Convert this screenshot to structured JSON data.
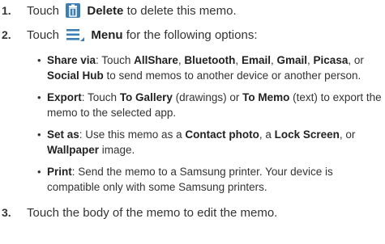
{
  "colors": {
    "text": "#333333",
    "icon_blue": "#3d7fb5"
  },
  "steps": [
    {
      "num": "1.",
      "pre": "Touch",
      "icon": "trash-icon",
      "bold": "Delete",
      "post": "to delete this memo."
    },
    {
      "num": "2.",
      "pre": "Touch",
      "icon": "menu-icon",
      "bold": "Menu",
      "post": "for the following options:"
    },
    {
      "num": "3.",
      "text": "Touch the body of the memo to edit the memo."
    }
  ],
  "bullets": {
    "share": {
      "term": "Share via",
      "t1": ": Touch ",
      "allshare": "AllShare",
      "bluetooth": "Bluetooth",
      "email": "Email",
      "gmail": "Gmail",
      "picasa": "Picasa",
      "comma": ",",
      "or": ", or",
      "socialhub": "Social Hub",
      "t2": "to send memos to another device or another person."
    },
    "export": {
      "term": "Export",
      "t1": ": Touch ",
      "gallery": "To Gallery",
      "t2": " (drawings) or ",
      "memo": "To Memo",
      "t3": " (text) to export the",
      "t4": "memo to the selected app."
    },
    "setas": {
      "term": "Set as",
      "t1": ": Use this memo as a ",
      "contact": "Contact photo",
      "t2": ", a ",
      "lock": "Lock Screen",
      "t3": ", or",
      "wallpaper": "Wallpaper",
      "t4": " image."
    },
    "print": {
      "term": "Print",
      "t1": ": Send the memo to a Samsung printer. Your device is",
      "t2": "compatible only with some Samsung printers."
    }
  }
}
